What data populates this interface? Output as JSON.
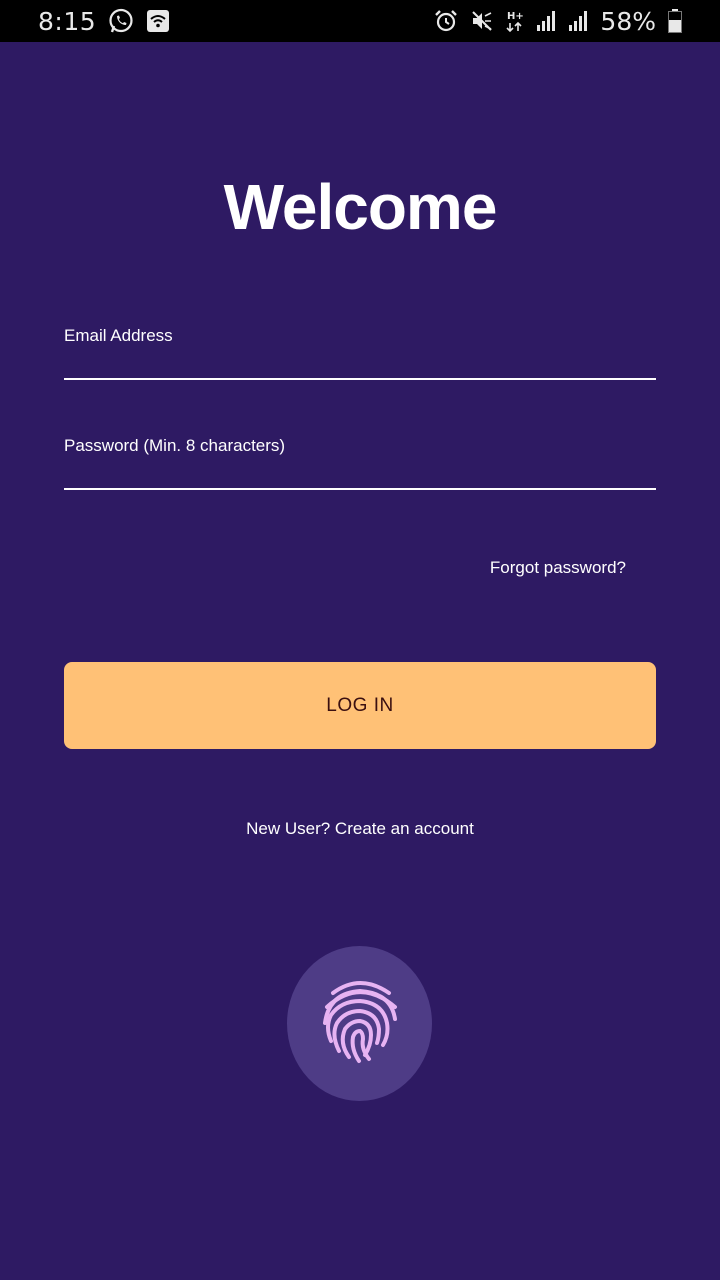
{
  "status_bar": {
    "time": "8:15",
    "battery_percent": "58%",
    "icons_left": [
      "whatsapp-icon",
      "wifi-icon"
    ],
    "icons_right": [
      "alarm-icon",
      "mute-icon",
      "network-type-icon",
      "signal-icon",
      "signal-icon",
      "battery-icon"
    ]
  },
  "login": {
    "title": "Welcome",
    "email_label": "Email Address",
    "email_value": "",
    "password_label": "Password (Min. 8 characters)",
    "password_value": "",
    "forgot_password": "Forgot password?",
    "login_button": "LOG IN",
    "create_account": "New User? Create an account",
    "biometric_icon": "fingerprint-icon"
  },
  "colors": {
    "background": "#2e1a63",
    "button": "#ffc176",
    "button_text": "#3a0f10",
    "fingerprint_circle": "#4e3c86",
    "fingerprint_lines": "#e7b3f2"
  }
}
